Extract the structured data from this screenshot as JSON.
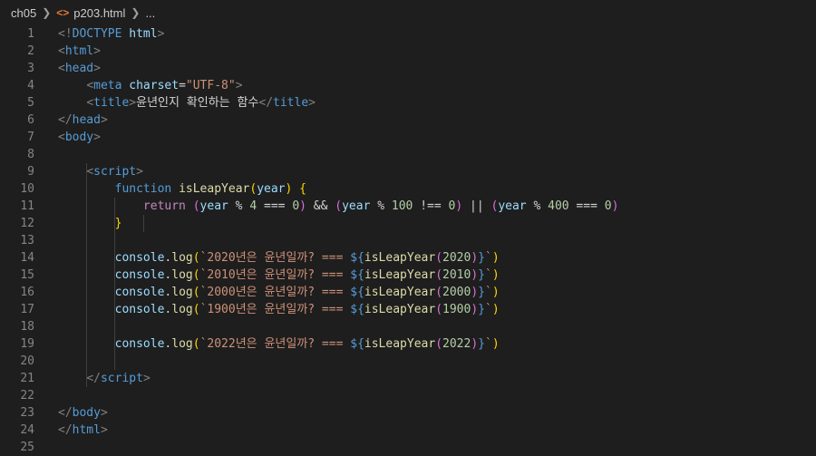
{
  "breadcrumb": {
    "folder": "ch05",
    "file": "p203.html",
    "more": "..."
  },
  "colors": {
    "background": "#1e1e1e",
    "line_number": "#858585",
    "tag": "#569cd6",
    "tag_bracket": "#808080",
    "attribute": "#9cdcfe",
    "string": "#ce9178",
    "text": "#d4d4d4",
    "keyword_function": "#569cd6",
    "control_keyword": "#c586c0",
    "function_name": "#dcdcaa",
    "parameter": "#9cdcfe",
    "number": "#b5cea8",
    "bracket_gold": "#ffd700",
    "bracket_pink": "#da70d6",
    "bracket_blue": "#179fff"
  },
  "lines": [
    [
      [
        "<!",
        "tb"
      ],
      [
        "DOCTYPE",
        "tg"
      ],
      [
        " ",
        "tx"
      ],
      [
        "html",
        "at"
      ],
      [
        ">",
        "tb"
      ]
    ],
    [
      [
        "<",
        "tb"
      ],
      [
        "html",
        "tg"
      ],
      [
        ">",
        "tb"
      ]
    ],
    [
      [
        "<",
        "tb"
      ],
      [
        "head",
        "tg"
      ],
      [
        ">",
        "tb"
      ]
    ],
    [
      [
        "    ",
        "tx"
      ],
      [
        "<",
        "tb"
      ],
      [
        "meta",
        "tg"
      ],
      [
        " ",
        "tx"
      ],
      [
        "charset",
        "at"
      ],
      [
        "=",
        "tx"
      ],
      [
        "\"UTF-8\"",
        "st"
      ],
      [
        ">",
        "tb"
      ]
    ],
    [
      [
        "    ",
        "tx"
      ],
      [
        "<",
        "tb"
      ],
      [
        "title",
        "tg"
      ],
      [
        ">",
        "tb"
      ],
      [
        "윤년인지 확인하는 함수",
        "tx"
      ],
      [
        "</",
        "tb"
      ],
      [
        "title",
        "tg"
      ],
      [
        ">",
        "tb"
      ]
    ],
    [
      [
        "</",
        "tb"
      ],
      [
        "head",
        "tg"
      ],
      [
        ">",
        "tb"
      ]
    ],
    [
      [
        "<",
        "tb"
      ],
      [
        "body",
        "tg"
      ],
      [
        ">",
        "tb"
      ]
    ],
    [],
    [
      [
        "    ",
        "tx"
      ],
      [
        "<",
        "tb"
      ],
      [
        "script",
        "tg"
      ],
      [
        ">",
        "tb"
      ]
    ],
    [
      [
        "        ",
        "tx"
      ],
      [
        "function",
        "kw"
      ],
      [
        " ",
        "tx"
      ],
      [
        "isLeapYear",
        "fn"
      ],
      [
        "(",
        "b1"
      ],
      [
        "year",
        "pa"
      ],
      [
        ")",
        "b1"
      ],
      [
        " ",
        "tx"
      ],
      [
        "{",
        "b1"
      ]
    ],
    [
      [
        "            ",
        "tx"
      ],
      [
        "return",
        "ck"
      ],
      [
        " ",
        "tx"
      ],
      [
        "(",
        "b2"
      ],
      [
        "year",
        "pa"
      ],
      [
        " % ",
        "tx"
      ],
      [
        "4",
        "nu"
      ],
      [
        " === ",
        "tx"
      ],
      [
        "0",
        "nu"
      ],
      [
        ")",
        "b2"
      ],
      [
        " && ",
        "tx"
      ],
      [
        "(",
        "b2"
      ],
      [
        "year",
        "pa"
      ],
      [
        " % ",
        "tx"
      ],
      [
        "100",
        "nu"
      ],
      [
        " !== ",
        "tx"
      ],
      [
        "0",
        "nu"
      ],
      [
        ")",
        "b2"
      ],
      [
        " || ",
        "tx"
      ],
      [
        "(",
        "b2"
      ],
      [
        "year",
        "pa"
      ],
      [
        " % ",
        "tx"
      ],
      [
        "400",
        "nu"
      ],
      [
        " === ",
        "tx"
      ],
      [
        "0",
        "nu"
      ],
      [
        ")",
        "b2"
      ]
    ],
    [
      [
        "        ",
        "tx"
      ],
      [
        "}",
        "b1"
      ]
    ],
    [],
    [
      [
        "        ",
        "tx"
      ],
      [
        "console",
        "pa"
      ],
      [
        ".",
        "tx"
      ],
      [
        "log",
        "fn"
      ],
      [
        "(",
        "b1"
      ],
      [
        "`2020년은 윤년일까? === ",
        "st"
      ],
      [
        "${",
        "kw"
      ],
      [
        "isLeapYear",
        "fn"
      ],
      [
        "(",
        "b2"
      ],
      [
        "2020",
        "nu"
      ],
      [
        ")",
        "b2"
      ],
      [
        "}",
        "kw"
      ],
      [
        "`",
        "st"
      ],
      [
        ")",
        "b1"
      ]
    ],
    [
      [
        "        ",
        "tx"
      ],
      [
        "console",
        "pa"
      ],
      [
        ".",
        "tx"
      ],
      [
        "log",
        "fn"
      ],
      [
        "(",
        "b1"
      ],
      [
        "`2010년은 윤년일까? === ",
        "st"
      ],
      [
        "${",
        "kw"
      ],
      [
        "isLeapYear",
        "fn"
      ],
      [
        "(",
        "b2"
      ],
      [
        "2010",
        "nu"
      ],
      [
        ")",
        "b2"
      ],
      [
        "}",
        "kw"
      ],
      [
        "`",
        "st"
      ],
      [
        ")",
        "b1"
      ]
    ],
    [
      [
        "        ",
        "tx"
      ],
      [
        "console",
        "pa"
      ],
      [
        ".",
        "tx"
      ],
      [
        "log",
        "fn"
      ],
      [
        "(",
        "b1"
      ],
      [
        "`2000년은 윤년일까? === ",
        "st"
      ],
      [
        "${",
        "kw"
      ],
      [
        "isLeapYear",
        "fn"
      ],
      [
        "(",
        "b2"
      ],
      [
        "2000",
        "nu"
      ],
      [
        ")",
        "b2"
      ],
      [
        "}",
        "kw"
      ],
      [
        "`",
        "st"
      ],
      [
        ")",
        "b1"
      ]
    ],
    [
      [
        "        ",
        "tx"
      ],
      [
        "console",
        "pa"
      ],
      [
        ".",
        "tx"
      ],
      [
        "log",
        "fn"
      ],
      [
        "(",
        "b1"
      ],
      [
        "`1900년은 윤년일까? === ",
        "st"
      ],
      [
        "${",
        "kw"
      ],
      [
        "isLeapYear",
        "fn"
      ],
      [
        "(",
        "b2"
      ],
      [
        "1900",
        "nu"
      ],
      [
        ")",
        "b2"
      ],
      [
        "}",
        "kw"
      ],
      [
        "`",
        "st"
      ],
      [
        ")",
        "b1"
      ]
    ],
    [],
    [
      [
        "        ",
        "tx"
      ],
      [
        "console",
        "pa"
      ],
      [
        ".",
        "tx"
      ],
      [
        "log",
        "fn"
      ],
      [
        "(",
        "b1"
      ],
      [
        "`2022년은 윤년일까? === ",
        "st"
      ],
      [
        "${",
        "kw"
      ],
      [
        "isLeapYear",
        "fn"
      ],
      [
        "(",
        "b2"
      ],
      [
        "2022",
        "nu"
      ],
      [
        ")",
        "b2"
      ],
      [
        "}",
        "kw"
      ],
      [
        "`",
        "st"
      ],
      [
        ")",
        "b1"
      ]
    ],
    [],
    [
      [
        "    ",
        "tx"
      ],
      [
        "</",
        "tb"
      ],
      [
        "script",
        "tg"
      ],
      [
        ">",
        "tb"
      ]
    ],
    [],
    [
      [
        "</",
        "tb"
      ],
      [
        "body",
        "tg"
      ],
      [
        ">",
        "tb"
      ]
    ],
    [
      [
        "</",
        "tb"
      ],
      [
        "html",
        "tg"
      ],
      [
        ">",
        "tb"
      ]
    ],
    []
  ]
}
